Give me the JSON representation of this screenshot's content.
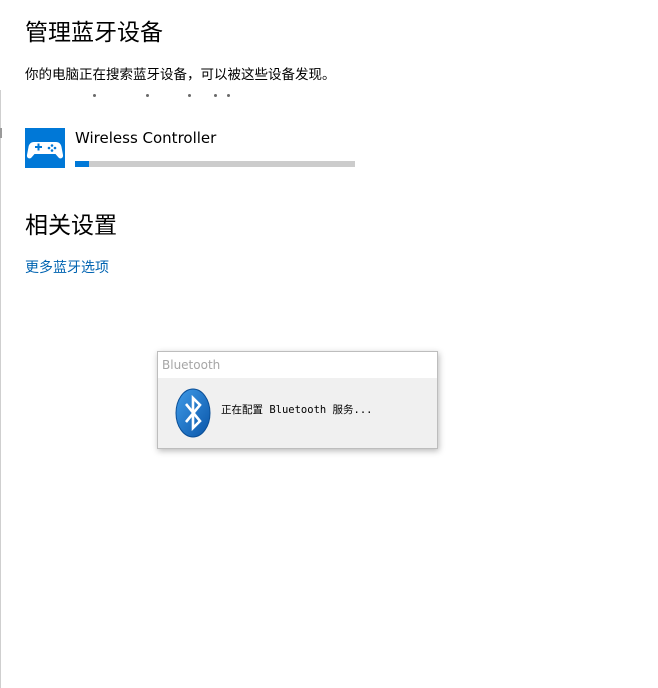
{
  "page": {
    "title": "管理蓝牙设备",
    "status_text": "你的电脑正在搜索蓝牙设备，可以被这些设备发现。"
  },
  "devices": [
    {
      "name": "Wireless Controller",
      "icon": "gamepad-icon",
      "progress_fraction": 0.05
    }
  ],
  "related": {
    "title": "相关设置",
    "link_label": "更多蓝牙选项"
  },
  "dialog": {
    "title": "Bluetooth",
    "icon": "bluetooth-icon",
    "message": "正在配置 Bluetooth 服务..."
  },
  "colors": {
    "accent": "#0078d7",
    "link": "#0063b1",
    "progress_track": "#cccccc"
  }
}
